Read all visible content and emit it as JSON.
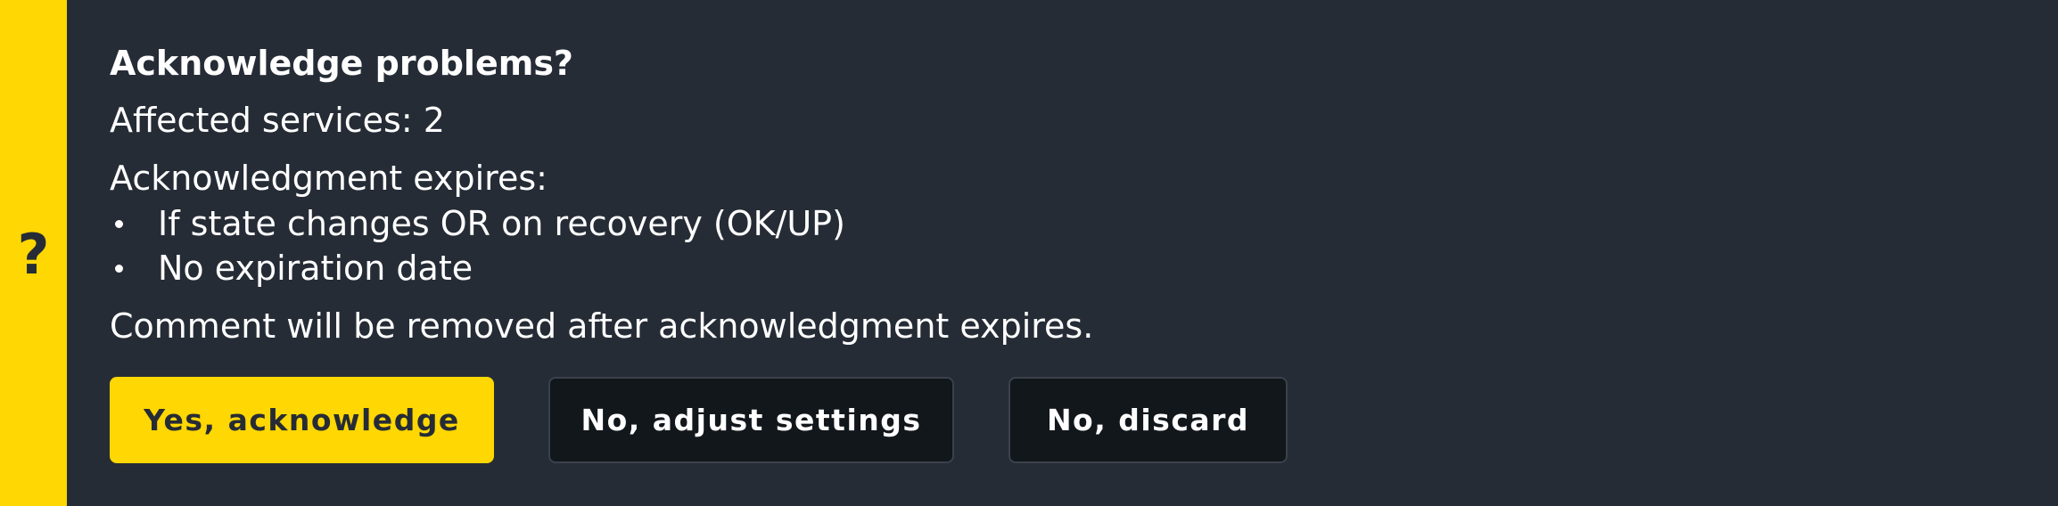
{
  "dialog": {
    "icon_glyph": "?",
    "icon_name": "question-icon",
    "title": "Acknowledge problems?",
    "affected_services": "Affected services: 2",
    "expires_label": "Acknowledgment expires:",
    "expiry_conditions": [
      "If state changes OR on recovery (OK/UP)",
      "No expiration date"
    ],
    "comment_note": "Comment will be removed after acknowledgment expires."
  },
  "buttons": {
    "yes_label": "Yes, acknowledge",
    "adjust_label": "No, adjust settings",
    "discard_label": "No, discard"
  },
  "colors": {
    "background": "#262c36",
    "accent": "#ffd703",
    "button_dark": "#12171c",
    "text": "#ffffff"
  }
}
